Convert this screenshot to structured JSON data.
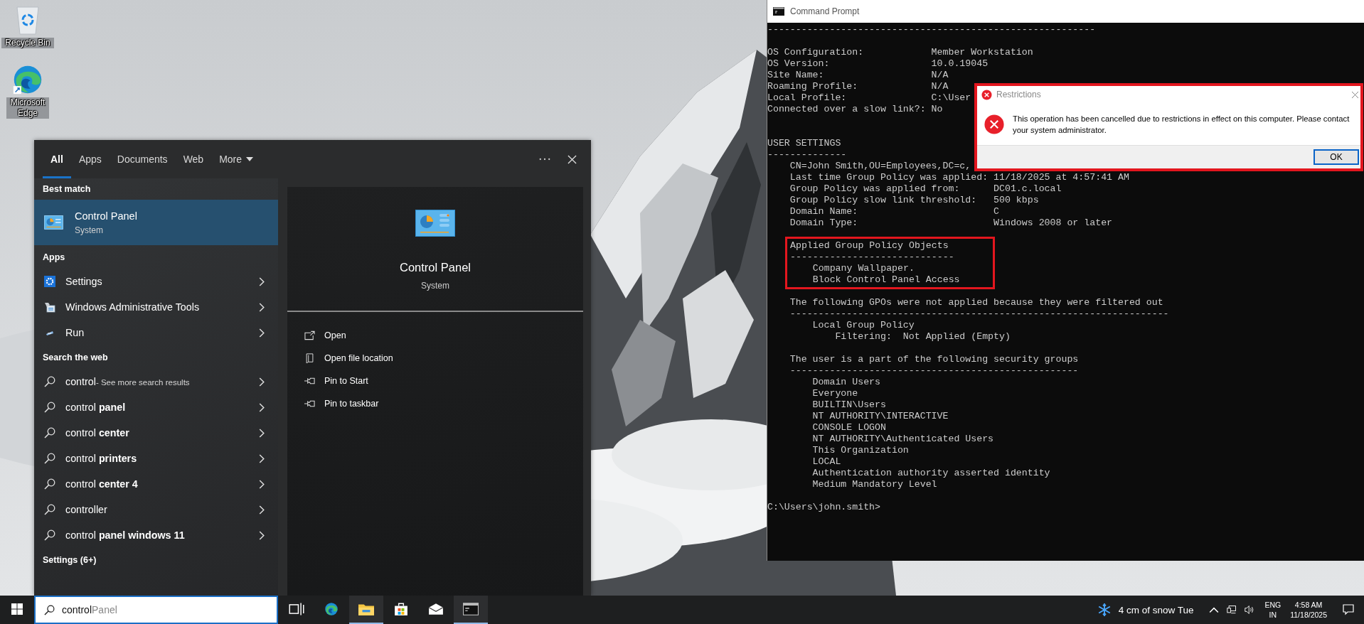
{
  "desktop": {
    "icons": [
      {
        "kind": "recycle-bin",
        "label": "Recycle Bin"
      },
      {
        "kind": "edge",
        "label": "Microsoft Edge"
      }
    ]
  },
  "search_panel": {
    "tabs": [
      {
        "label": "All",
        "selected": true,
        "dropdown": false
      },
      {
        "label": "Apps",
        "selected": false,
        "dropdown": false
      },
      {
        "label": "Documents",
        "selected": false,
        "dropdown": false
      },
      {
        "label": "Web",
        "selected": false,
        "dropdown": false
      },
      {
        "label": "More",
        "selected": false,
        "dropdown": true
      }
    ],
    "best_match": {
      "heading": "Best match",
      "title": "Control Panel",
      "subtitle": "System",
      "selected": true
    },
    "apps": {
      "heading": "Apps",
      "items": [
        {
          "kind": "settings",
          "label": "Settings"
        },
        {
          "kind": "admin-tools",
          "label": "Windows Administrative Tools"
        },
        {
          "kind": "run",
          "label": "Run"
        }
      ]
    },
    "web": {
      "heading": "Search the web",
      "items": [
        {
          "text": "control",
          "note": "- See more search results"
        },
        {
          "text": "control **panel**"
        },
        {
          "text": "control **center**"
        },
        {
          "text": "control **printers**"
        },
        {
          "text": "control **center 4**"
        },
        {
          "text": "controller"
        },
        {
          "text": "control **panel windows 11**"
        }
      ]
    },
    "more_heading": "Settings (6+)",
    "preview": {
      "title": "Control Panel",
      "subtitle": "System",
      "actions": [
        {
          "kind": "open",
          "label": "Open"
        },
        {
          "kind": "folder",
          "label": "Open file location"
        },
        {
          "kind": "pin",
          "label": "Pin to Start"
        },
        {
          "kind": "pin",
          "label": "Pin to taskbar"
        }
      ]
    }
  },
  "console": {
    "title": "Command Prompt",
    "blocks": [
      {
        "kind": "text",
        "lines": [
          "----------------------------------------------------------"
        ]
      },
      {
        "kind": "text",
        "lines": [
          "OS Configuration:            Member Workstation",
          "OS Version:                  10.0.19045",
          "Site Name:                   N/A",
          "Roaming Profile:             N/A",
          "Local Profile:               C:\\User",
          "Connected over a slow link?: No"
        ]
      },
      {
        "kind": "section",
        "lines": [
          "USER SETTINGS",
          "--------------",
          "    CN=John Smith,OU=Employees,DC=c,",
          "    Last time Group Policy was applied: 11/18/2025 at 4:57:41 AM",
          "    Group Policy was applied from:      DC01.c.local",
          "    Group Policy slow link threshold:   500 kbps",
          "    Domain Name:                        C",
          "    Domain Type:                        Windows 2008 or later"
        ]
      },
      {
        "kind": "highlight",
        "lines": [
          "Applied Group Policy Objects",
          "-----------------------------",
          "    Company Wallpaper.",
          "    Block Control Panel Access"
        ]
      },
      {
        "kind": "text",
        "lines": [
          "    The following GPOs were not applied because they were filtered out",
          "    -------------------------------------------------------------------",
          "        Local Group Policy",
          "            Filtering:  Not Applied (Empty)"
        ]
      },
      {
        "kind": "text",
        "lines": [
          "    The user is a part of the following security groups",
          "    ---------------------------------------------------",
          "        Domain Users",
          "        Everyone",
          "        BUILTIN\\Users",
          "        NT AUTHORITY\\INTERACTIVE",
          "        CONSOLE LOGON",
          "        NT AUTHORITY\\Authenticated Users",
          "        This Organization",
          "        LOCAL",
          "        Authentication authority asserted identity",
          "        Medium Mandatory Level"
        ]
      },
      {
        "kind": "text",
        "lines": [
          "C:\\Users\\john.smith>"
        ]
      }
    ]
  },
  "dialog": {
    "title": "Restrictions",
    "message": "This operation has been cancelled due to restrictions in effect on this computer. Please contact your system administrator.",
    "button": "OK"
  },
  "taskbar": {
    "search": {
      "value": "control",
      "suggestion": "Panel"
    },
    "apps": [
      {
        "kind": "task-view",
        "running": false
      },
      {
        "kind": "edge",
        "running": false
      },
      {
        "kind": "explorer",
        "running": true
      },
      {
        "kind": "store",
        "running": false
      },
      {
        "kind": "mail",
        "running": false
      },
      {
        "kind": "terminal",
        "running": true
      }
    ],
    "weather": "4 cm of snow Tue",
    "language": "ENG",
    "region": "IN",
    "time": "4:58 AM",
    "date": "11/18/2025"
  }
}
